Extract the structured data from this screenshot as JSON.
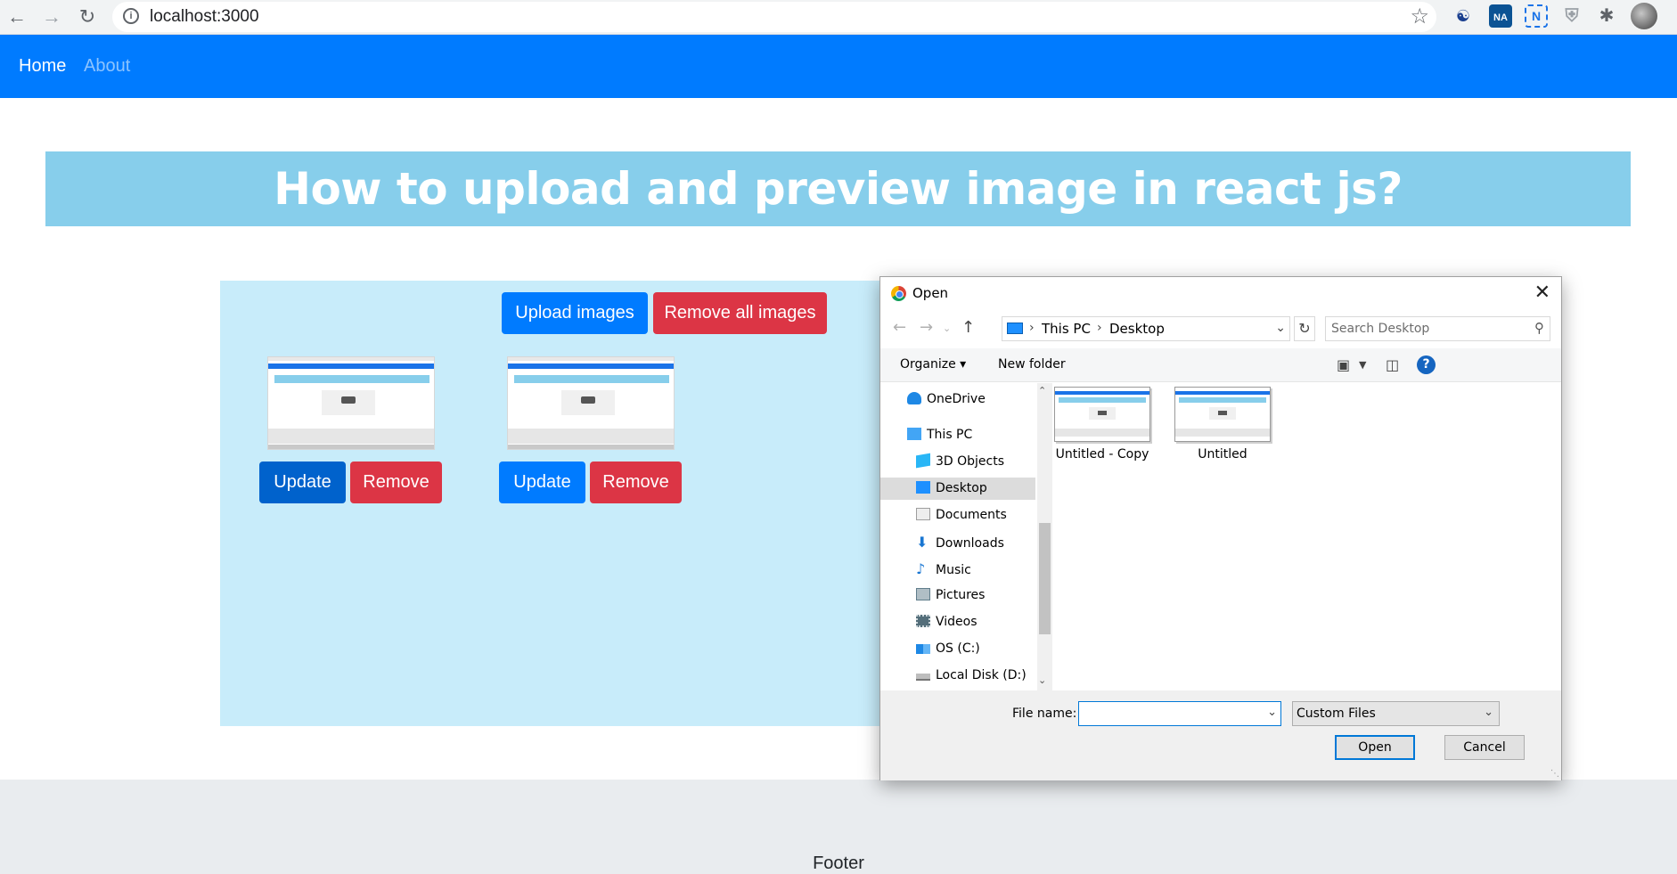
{
  "browser": {
    "url": "localhost:3000",
    "ext_badge": "NA",
    "ext_letter": "N"
  },
  "navbar": {
    "home_label": "Home",
    "about_label": "About"
  },
  "banner": {
    "title": "How to upload and preview image in react js?"
  },
  "upload": {
    "upload_label": "Upload images",
    "remove_all_label": "Remove all images",
    "items": [
      {
        "update_label": "Update",
        "remove_label": "Remove"
      },
      {
        "update_label": "Update",
        "remove_label": "Remove"
      }
    ]
  },
  "footer": {
    "text": "Footer"
  },
  "dialog": {
    "title": "Open",
    "path": [
      "This PC",
      "Desktop"
    ],
    "search_placeholder": "Search Desktop",
    "toolbar": {
      "organize_label": "Organize",
      "new_folder_label": "New folder"
    },
    "nav_items": [
      {
        "label": "OneDrive",
        "icon": "cloud-icon",
        "color": "#1e88e5"
      },
      {
        "label": "This PC",
        "icon": "computer-icon",
        "color": "#42a5f5"
      },
      {
        "label": "3D Objects",
        "icon": "cube-icon",
        "color": "#29b6f6"
      },
      {
        "label": "Desktop",
        "icon": "desktop-icon",
        "color": "#1e90ff"
      },
      {
        "label": "Documents",
        "icon": "document-icon",
        "color": "#9e9e9e"
      },
      {
        "label": "Downloads",
        "icon": "download-icon",
        "color": "#1976d2"
      },
      {
        "label": "Music",
        "icon": "music-icon",
        "color": "#1976d2"
      },
      {
        "label": "Pictures",
        "icon": "pictures-icon",
        "color": "#607d8b"
      },
      {
        "label": "Videos",
        "icon": "video-icon",
        "color": "#546e7a"
      },
      {
        "label": "OS (C:)",
        "icon": "drive-icon",
        "color": "#1e88e5"
      },
      {
        "label": "Local Disk (D:)",
        "icon": "disk-icon",
        "color": "#757575"
      }
    ],
    "files": [
      {
        "name": "Untitled - Copy"
      },
      {
        "name": "Untitled"
      }
    ],
    "filename_label": "File name:",
    "filename_value": "",
    "filetype_value": "Custom Files",
    "open_label": "Open",
    "cancel_label": "Cancel"
  },
  "colors": {
    "navbar": "#007bff",
    "banner": "#87ceeb",
    "upload_area": "#c8ecfa",
    "danger": "#dc3545",
    "footer": "#e9ecef"
  }
}
